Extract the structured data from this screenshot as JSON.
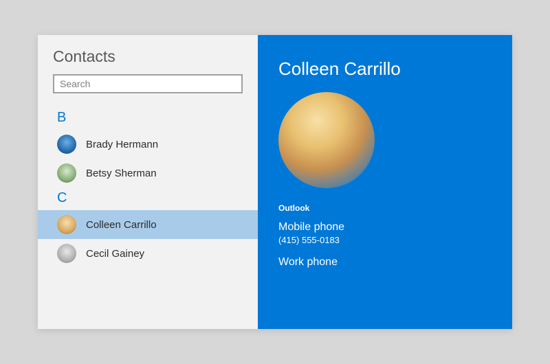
{
  "app_title": "Contacts",
  "search": {
    "placeholder": "Search",
    "value": ""
  },
  "groups": [
    {
      "letter": "B",
      "items": [
        {
          "name": "Brady Hermann",
          "avatar_class": "av-blue",
          "selected": false
        },
        {
          "name": "Betsy Sherman",
          "avatar_class": "av-green",
          "selected": false
        }
      ]
    },
    {
      "letter": "C",
      "items": [
        {
          "name": "Colleen Carrillo",
          "avatar_class": "av-gold",
          "selected": true
        },
        {
          "name": "Cecil Gainey",
          "avatar_class": "av-grey",
          "selected": false
        }
      ]
    }
  ],
  "detail": {
    "name": "Colleen Carrillo",
    "section_label": "Outlook",
    "fields": [
      {
        "label": "Mobile phone",
        "value": "(415) 555-0183"
      },
      {
        "label": "Work phone",
        "value": ""
      }
    ]
  },
  "colors": {
    "accent": "#0078d7",
    "selection": "#a8cbe9"
  }
}
